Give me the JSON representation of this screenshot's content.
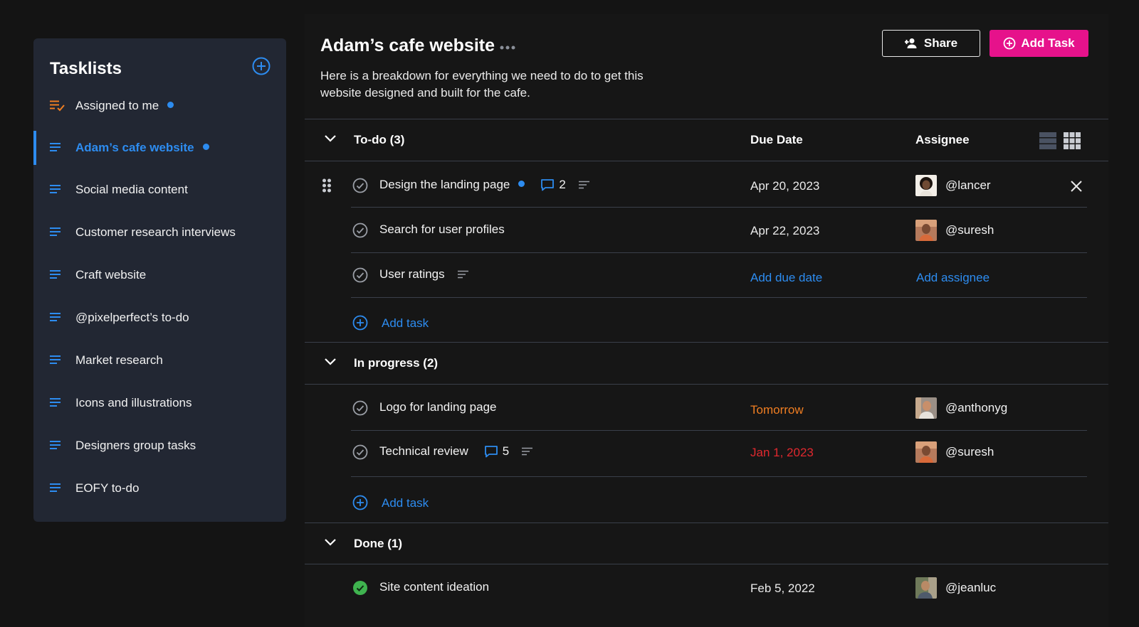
{
  "sidebar": {
    "title": "Tasklists",
    "items": [
      {
        "label": "Assigned to me",
        "icon": "assigned-list-icon",
        "dot": true,
        "active": false
      },
      {
        "label": "Adam’s cafe website",
        "icon": "list-icon",
        "dot": true,
        "active": true
      },
      {
        "label": "Social media content",
        "icon": "list-icon"
      },
      {
        "label": "Customer research interviews",
        "icon": "list-icon"
      },
      {
        "label": "Craft website",
        "icon": "list-icon"
      },
      {
        "label": "@pixelperfect’s to-do",
        "icon": "list-icon"
      },
      {
        "label": "Market research",
        "icon": "list-icon"
      },
      {
        "label": "Icons and illustrations",
        "icon": "list-icon"
      },
      {
        "label": "Designers group tasks",
        "icon": "list-icon"
      },
      {
        "label": "EOFY to-do",
        "icon": "list-icon"
      }
    ]
  },
  "header": {
    "title": "Adam’s cafe website",
    "description": "Here is a breakdown for everything we need to do to get this website designed and built for the cafe.",
    "share_label": "Share",
    "add_task_label": "Add Task"
  },
  "columns": {
    "due": "Due Date",
    "assignee": "Assignee"
  },
  "sections": [
    {
      "name": "To-do (3)",
      "tasks": [
        {
          "title": "Design the landing page",
          "comments": "2",
          "due": "Apr 20, 2023",
          "assignee": "@lancer"
        },
        {
          "title": "Search for user profiles",
          "due": "Apr 22, 2023",
          "assignee": "@suresh"
        },
        {
          "title": "User ratings",
          "due": "Add due date",
          "assignee": "Add assignee"
        }
      ],
      "add_label": "Add task"
    },
    {
      "name": "In progress (2)",
      "tasks": [
        {
          "title": "Logo for landing page",
          "due": "Tomorrow",
          "assignee": "@anthonyg"
        },
        {
          "title": "Technical review",
          "comments": "5",
          "due": "Jan 1, 2023",
          "assignee": "@suresh"
        }
      ],
      "add_label": "Add task"
    },
    {
      "name": "Done (1)",
      "tasks": [
        {
          "title": "Site content ideation",
          "due": "Feb 5, 2022",
          "assignee": "@jeanluc"
        }
      ]
    }
  ],
  "colors": {
    "accent": "#2d8cf0",
    "brand": "#e6128b",
    "warning": "#f07e22",
    "overdue": "#e0282e",
    "done": "#3fb34f"
  }
}
